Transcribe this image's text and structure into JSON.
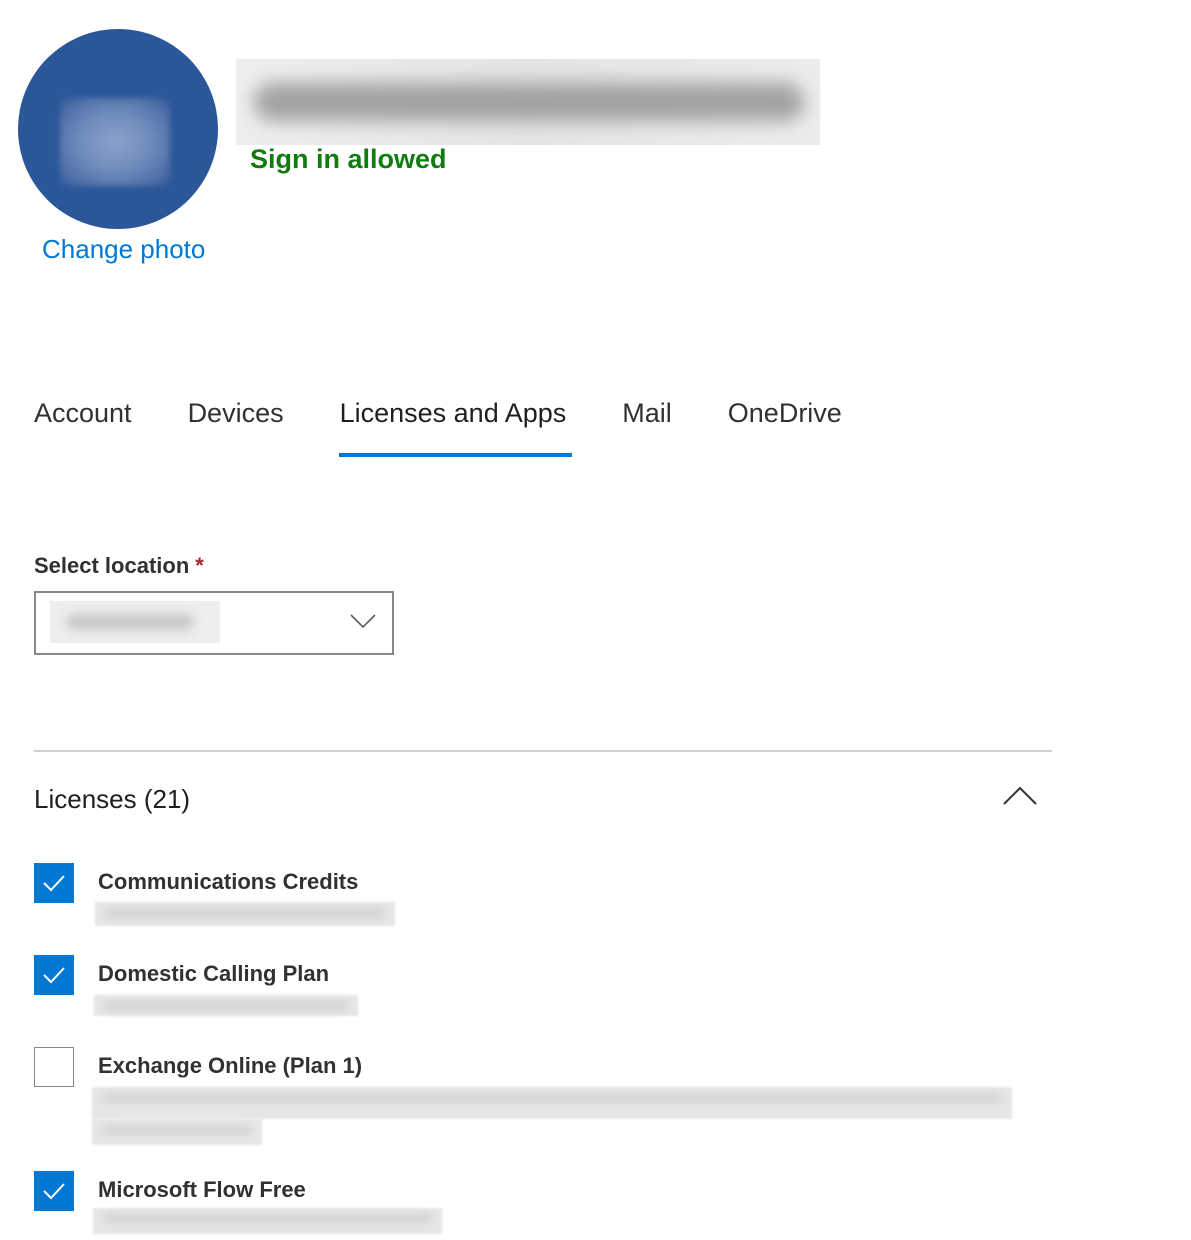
{
  "profile": {
    "change_photo_label": "Change photo",
    "sign_in_status": "Sign in allowed",
    "status_color": "#107c10",
    "avatar_color": "#2b579a"
  },
  "tabs": [
    {
      "label": "Account",
      "active": false
    },
    {
      "label": "Devices",
      "active": false
    },
    {
      "label": "Licenses and Apps",
      "active": true
    },
    {
      "label": "Mail",
      "active": false
    },
    {
      "label": "OneDrive",
      "active": false
    }
  ],
  "location": {
    "label": "Select location",
    "required_marker": "*",
    "dropdown_icon": "chevron-down-icon"
  },
  "licenses": {
    "title": "Licenses (21)",
    "collapse_icon": "chevron-up-icon",
    "items": [
      {
        "name": "Communications Credits",
        "checked": true
      },
      {
        "name": "Domestic Calling Plan",
        "checked": true
      },
      {
        "name": "Exchange Online (Plan 1)",
        "checked": false
      },
      {
        "name": "Microsoft Flow Free",
        "checked": true
      }
    ]
  },
  "colors": {
    "accent": "#0078d4",
    "required": "#a4262c"
  }
}
